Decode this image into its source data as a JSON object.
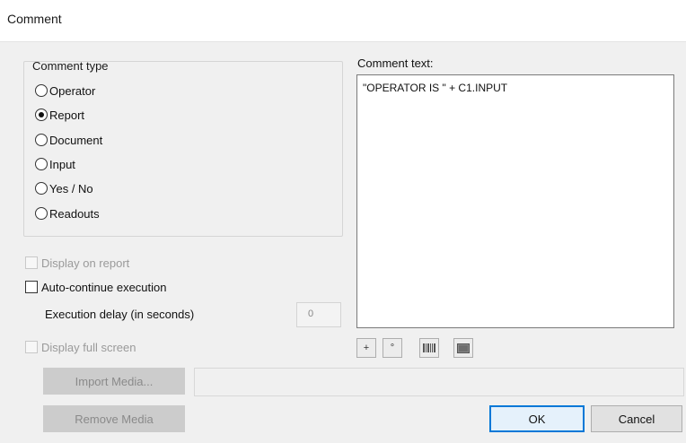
{
  "window": {
    "title": "Comment"
  },
  "comment_type": {
    "label": "Comment type",
    "options": [
      {
        "label": "Operator",
        "checked": false
      },
      {
        "label": "Report",
        "checked": true
      },
      {
        "label": "Document",
        "checked": false
      },
      {
        "label": "Input",
        "checked": false
      },
      {
        "label": "Yes / No",
        "checked": false
      },
      {
        "label": "Readouts",
        "checked": false
      }
    ]
  },
  "options": {
    "display_on_report": {
      "label": "Display on report",
      "checked": false,
      "enabled": false
    },
    "auto_continue": {
      "label": "Auto-continue execution",
      "checked": false,
      "enabled": true
    },
    "execution_delay": {
      "label": "Execution delay (in seconds)",
      "value": "0",
      "enabled": false
    },
    "display_full_screen": {
      "label": "Display full screen",
      "checked": false,
      "enabled": false
    }
  },
  "comment_text": {
    "label": "Comment text:",
    "value": "\"OPERATOR IS \" + C1.INPUT"
  },
  "toolbar": {
    "buttons": [
      {
        "icon": "plus-icon",
        "glyph": "+"
      },
      {
        "icon": "degree-icon",
        "glyph": "°"
      },
      {
        "icon": "barcode-icon"
      },
      {
        "icon": "image-icon"
      }
    ]
  },
  "media": {
    "import_label": "Import Media...",
    "remove_label": "Remove Media",
    "path_value": ""
  },
  "actions": {
    "ok_label": "OK",
    "cancel_label": "Cancel"
  },
  "colors": {
    "accent": "#0078d7",
    "dialog_bg": "#f0f0f0"
  }
}
